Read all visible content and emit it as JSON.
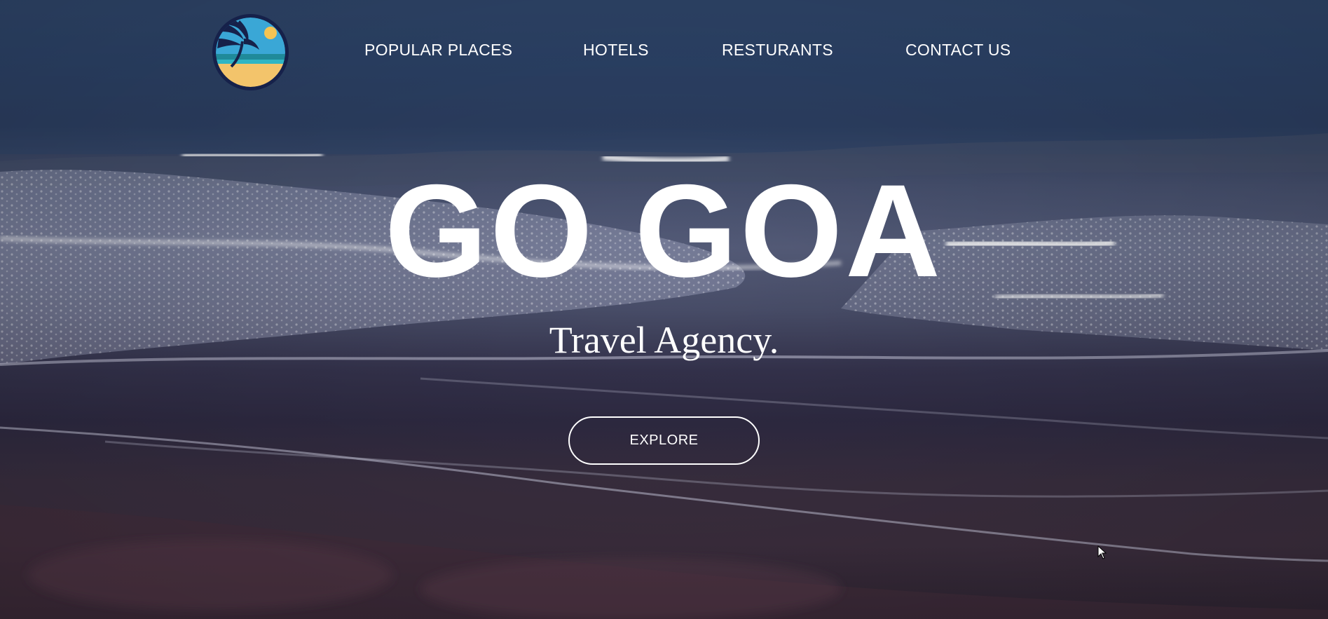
{
  "nav": {
    "items": [
      {
        "label": "POPULAR PLACES"
      },
      {
        "label": "HOTELS"
      },
      {
        "label": "RESTURANTS"
      },
      {
        "label": "CONTACT US"
      }
    ]
  },
  "hero": {
    "title": "GO GOA",
    "subtitle": "Travel Agency.",
    "cta_label": "EXPLORE"
  },
  "logo": {
    "icon": "palm-beach-logo",
    "colors": {
      "ring": "#16214a",
      "sky": "#3aa7d6",
      "sea": "#1f8a9a",
      "sand": "#f3c46b",
      "sun": "#f5c453"
    }
  },
  "theme": {
    "text_color": "#ffffff",
    "background": "aerial ocean waves"
  }
}
